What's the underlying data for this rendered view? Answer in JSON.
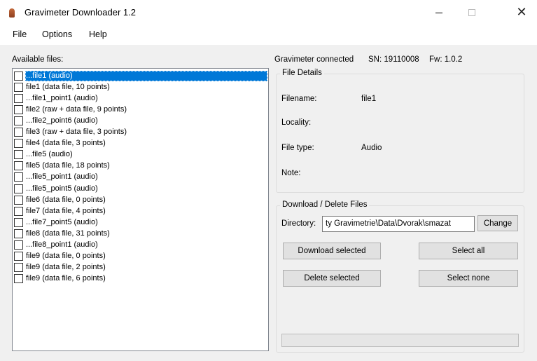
{
  "window": {
    "title": "Gravimeter Downloader 1.2",
    "icon": "gravimeter-app-icon",
    "controls": {
      "minimize": "—",
      "maximize": "☐",
      "close": "✕"
    }
  },
  "menu": {
    "file": "File",
    "options": "Options",
    "help": "Help"
  },
  "files": {
    "label": "Available files:",
    "items": [
      {
        "label": "...file1 (audio)",
        "checked": false,
        "selected": true
      },
      {
        "label": "file1 (data file, 10 points)",
        "checked": false
      },
      {
        "label": "...file1_point1 (audio)",
        "checked": false
      },
      {
        "label": "file2 (raw + data file, 9 points)",
        "checked": false
      },
      {
        "label": "...file2_point6 (audio)",
        "checked": false
      },
      {
        "label": "file3 (raw + data file, 3 points)",
        "checked": false
      },
      {
        "label": "file4 (data file, 3 points)",
        "checked": false
      },
      {
        "label": "...file5 (audio)",
        "checked": false
      },
      {
        "label": "file5 (data file, 18 points)",
        "checked": false
      },
      {
        "label": "...file5_point1 (audio)",
        "checked": false
      },
      {
        "label": "...file5_point5 (audio)",
        "checked": false
      },
      {
        "label": "file6 (data file, 0 points)",
        "checked": false
      },
      {
        "label": "file7 (data file, 4 points)",
        "checked": false
      },
      {
        "label": "...file7_point5 (audio)",
        "checked": false
      },
      {
        "label": "file8 (data file, 31 points)",
        "checked": false
      },
      {
        "label": "...file8_point1 (audio)",
        "checked": false
      },
      {
        "label": "file9 (data file, 0 points)",
        "checked": false
      },
      {
        "label": "file9 (data file, 2 points)",
        "checked": false
      },
      {
        "label": "file9 (data file, 6 points)",
        "checked": false
      }
    ]
  },
  "status": {
    "connection": "Gravimeter connected",
    "serial": "SN: 19110008",
    "firmware": "Fw: 1.0.2"
  },
  "details": {
    "title": "File Details",
    "filename_label": "Filename:",
    "filename_value": "file1",
    "locality_label": "Locality:",
    "locality_value": "",
    "filetype_label": "File type:",
    "filetype_value": "Audio",
    "note_label": "Note:",
    "note_value": ""
  },
  "download": {
    "title": "Download / Delete Files",
    "directory_label": "Directory:",
    "directory_value": "ty Gravimetrie\\Data\\Dvorak\\smazat",
    "change_button": "Change",
    "download_button": "Download selected",
    "select_all_button": "Select all",
    "delete_button": "Delete selected",
    "select_none_button": "Select none",
    "progress": 0
  },
  "colors": {
    "selection": "#0078d7",
    "window_bg": "#f0f0f0",
    "button_bg": "#e1e1e1"
  }
}
